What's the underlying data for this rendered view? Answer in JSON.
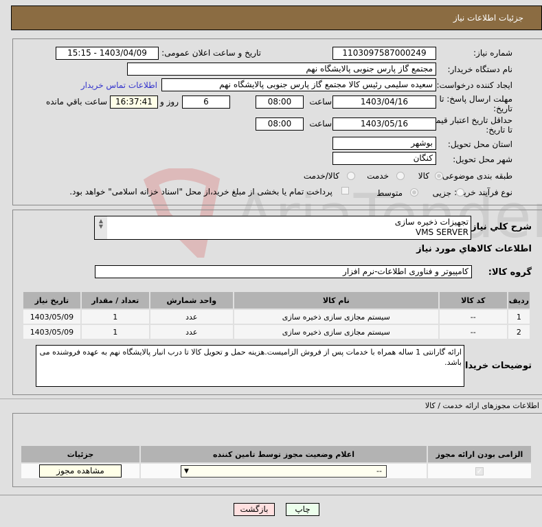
{
  "header": {
    "title": "جزئیات اطلاعات نیاز"
  },
  "form": {
    "need_number_label": "شماره نیاز:",
    "need_number": "1103097587000249",
    "announce_label": "تاریخ و ساعت اعلان عمومی:",
    "announce_value": "1403/04/09 - 15:15",
    "buyer_org_label": "نام دستگاه خریدار:",
    "buyer_org": "مجتمع گاز پارس جنوبی  پالایشگاه نهم",
    "creator_label": "ایجاد کننده درخواست:",
    "creator": "سعیده سلیمی رئیس کالا مجتمع گاز پارس جنوبی  پالایشگاه نهم",
    "buyer_contact_link": "اطلاعات تماس خریدار",
    "reply_deadline_label": "مهلت ارسال پاسخ: تا تاریخ:",
    "reply_date": "1403/04/16",
    "time_label": "ساعت",
    "reply_time": "08:00",
    "days_value": "6",
    "days_label": "روز و",
    "remaining_time": "16:37:41",
    "remaining_label": "ساعت باقي مانده",
    "price_validity_label": "حداقل تاریخ اعتبار قیمت: تا تاریخ:",
    "price_date": "1403/05/16",
    "price_time": "08:00",
    "province_label": "استان محل تحویل:",
    "province": "بوشهر",
    "city_label": "شهر محل تحویل:",
    "city": "کنگان",
    "category_label": "طبقه بندی موضوعی:",
    "category_options": [
      "کالا",
      "خدمت",
      "کالا/خدمت"
    ],
    "category_selected": "کالا",
    "process_label": "نوع فرآیند خرید :",
    "process_options": [
      "جزیی",
      "متوسط"
    ],
    "process_selected": "متوسط",
    "payment_note": "پرداخت تمام یا بخشی از مبلغ خرید،از محل \"اسناد خزانه اسلامی\" خواهد بود."
  },
  "description": {
    "label": "شرح کلي نياز:",
    "line1": "تجهیزات ذخیره سازی",
    "line2": "VMS SERVER"
  },
  "goods": {
    "section_title": "اطلاعات کالاهاي مورد نياز",
    "group_label": "گروه کالا:",
    "group_value": "کامپیوتر و فناوری اطلاعات-نرم افزار",
    "columns": [
      "ردیف",
      "کد کالا",
      "نام کالا",
      "واحد شمارش",
      "تعداد / مقدار",
      "تاریخ نیاز"
    ],
    "rows": [
      {
        "idx": "1",
        "code": "--",
        "name": "سیستم مجازی سازی ذخیره سازی",
        "unit": "عدد",
        "qty": "1",
        "date": "1403/05/09"
      },
      {
        "idx": "2",
        "code": "--",
        "name": "سیستم مجازی سازی ذخیره سازی",
        "unit": "عدد",
        "qty": "1",
        "date": "1403/05/09"
      }
    ]
  },
  "buyer_notes": {
    "label": "توضیحات خریدار:",
    "text": "ارائه گارانتی 1 ساله همراه با خدمات پس از فروش الزامیست.هزینه حمل و تحویل کالا تا درب انبار پالایشگاه نهم به عهده فروشنده می باشد."
  },
  "permits": {
    "title": "اطلاعات مجوزهای ارائه خدمت / کالا",
    "columns": [
      "الزامی بودن ارائه مجوز",
      "اعلام وضعیت مجوز توسط تامین کننده",
      "جزئیات"
    ],
    "select_value": "--",
    "view_button": "مشاهده مجوز"
  },
  "footer": {
    "print": "چاپ",
    "back": "بازگشت"
  },
  "watermark": "AriaTender.neT"
}
